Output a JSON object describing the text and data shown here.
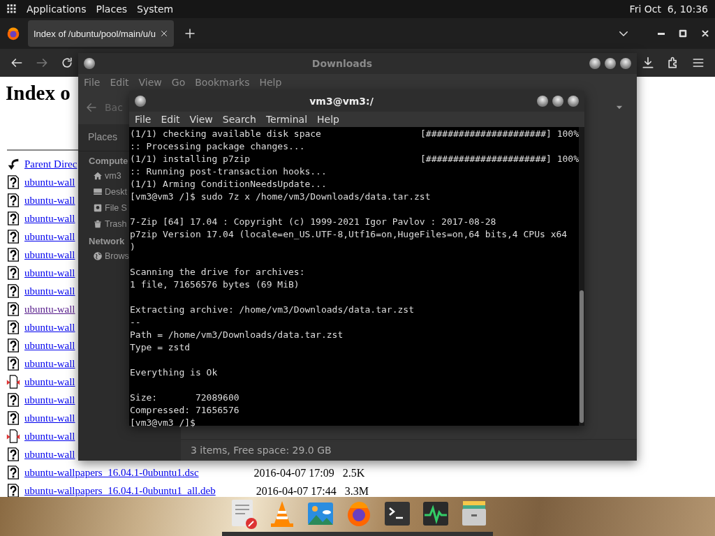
{
  "top_panel": {
    "menus": [
      "Applications",
      "Places",
      "System"
    ],
    "clock": "Fri Oct  6, 10:36"
  },
  "browser": {
    "tab": {
      "title": "Index of /ubuntu/pool/main/u/u"
    },
    "page": {
      "heading": "Index o",
      "entries": [
        {
          "name": "Parent Direc",
          "kind": "parent",
          "visited": false
        },
        {
          "name": "ubuntu-wall",
          "kind": "unknown",
          "visited": false
        },
        {
          "name": "ubuntu-wall",
          "kind": "unknown",
          "visited": false
        },
        {
          "name": "ubuntu-wall",
          "kind": "unknown",
          "visited": false
        },
        {
          "name": "ubuntu-wall",
          "kind": "unknown",
          "visited": false
        },
        {
          "name": "ubuntu-wall",
          "kind": "unknown",
          "visited": false
        },
        {
          "name": "ubuntu-wall",
          "kind": "unknown",
          "visited": false
        },
        {
          "name": "ubuntu-wall",
          "kind": "unknown",
          "visited": false
        },
        {
          "name": "ubuntu-wall",
          "kind": "unknown",
          "visited": true
        },
        {
          "name": "ubuntu-wall",
          "kind": "unknown",
          "visited": false
        },
        {
          "name": "ubuntu-wall",
          "kind": "unknown",
          "visited": false
        },
        {
          "name": "ubuntu-wall",
          "kind": "unknown",
          "visited": false
        },
        {
          "name": "ubuntu-wall",
          "kind": "package",
          "visited": false
        },
        {
          "name": "ubuntu-wall",
          "kind": "unknown",
          "visited": false
        },
        {
          "name": "ubuntu-wall",
          "kind": "unknown",
          "visited": false
        },
        {
          "name": "ubuntu-wall",
          "kind": "package",
          "visited": false
        },
        {
          "name": "ubuntu-wall",
          "kind": "unknown",
          "visited": false
        },
        {
          "name": "ubuntu-wallpapers_16.04.1-0ubuntu1.dsc",
          "kind": "unknown",
          "visited": false,
          "date": "2016-04-07 17:09",
          "size": "2.5K"
        },
        {
          "name": "ubuntu-wallpapers_16.04.1-0ubuntu1_all.deb",
          "kind": "unknown",
          "visited": false,
          "date": "2016-04-07 17:44",
          "size": "3.3M"
        }
      ]
    }
  },
  "file_manager": {
    "title": "Downloads",
    "menus": [
      "File",
      "Edit",
      "View",
      "Go",
      "Bookmarks",
      "Help"
    ],
    "back_label": "Bac",
    "sidebar": {
      "header": "Places",
      "sections": [
        {
          "title": "Compute",
          "items": [
            {
              "label": "vm3",
              "kind": "home"
            },
            {
              "label": "Deskt",
              "kind": "desktop"
            },
            {
              "label": "File S",
              "kind": "drive"
            },
            {
              "label": "Trash",
              "kind": "trash"
            }
          ]
        },
        {
          "title": "Network",
          "items": [
            {
              "label": "Brows",
              "kind": "network"
            }
          ]
        }
      ]
    },
    "status": "3 items, Free space: 29.0 GB"
  },
  "terminal": {
    "title": "vm3@vm3:/",
    "menus": [
      "File",
      "Edit",
      "View",
      "Search",
      "Terminal",
      "Help"
    ],
    "blocks": [
      [
        {
          "text": "(1/1) checking available disk space",
          "progress": "[######################] 100%"
        },
        {
          "text": ":: Processing package changes..."
        },
        {
          "text": "(1/1) installing p7zip",
          "progress": "[######################] 100%"
        },
        {
          "text": ":: Running post-transaction hooks..."
        },
        {
          "text": "(1/1) Arming ConditionNeedsUpdate..."
        },
        {
          "text": "[vm3@vm3 /]$ sudo 7z x /home/vm3/Downloads/data.tar.zst"
        }
      ],
      [
        {
          "text": "7-Zip [64] 17.04 : Copyright (c) 1999-2021 Igor Pavlov : 2017-08-28"
        },
        {
          "text": "p7zip Version 17.04 (locale=en_US.UTF-8,Utf16=on,HugeFiles=on,64 bits,4 CPUs x64"
        },
        {
          "text": ")"
        }
      ],
      [
        {
          "text": "Scanning the drive for archives:"
        },
        {
          "text": "1 file, 71656576 bytes (69 MiB)"
        }
      ],
      [
        {
          "text": "Extracting archive: /home/vm3/Downloads/data.tar.zst"
        },
        {
          "text": "--"
        },
        {
          "text": "Path = /home/vm3/Downloads/data.tar.zst"
        },
        {
          "text": "Type = zstd"
        }
      ],
      [
        {
          "text": "Everything is Ok"
        }
      ],
      [
        {
          "text": "Size:       72089600"
        },
        {
          "text": "Compressed: 71656576"
        },
        {
          "text": "[vm3@vm3 /]$"
        }
      ]
    ]
  }
}
